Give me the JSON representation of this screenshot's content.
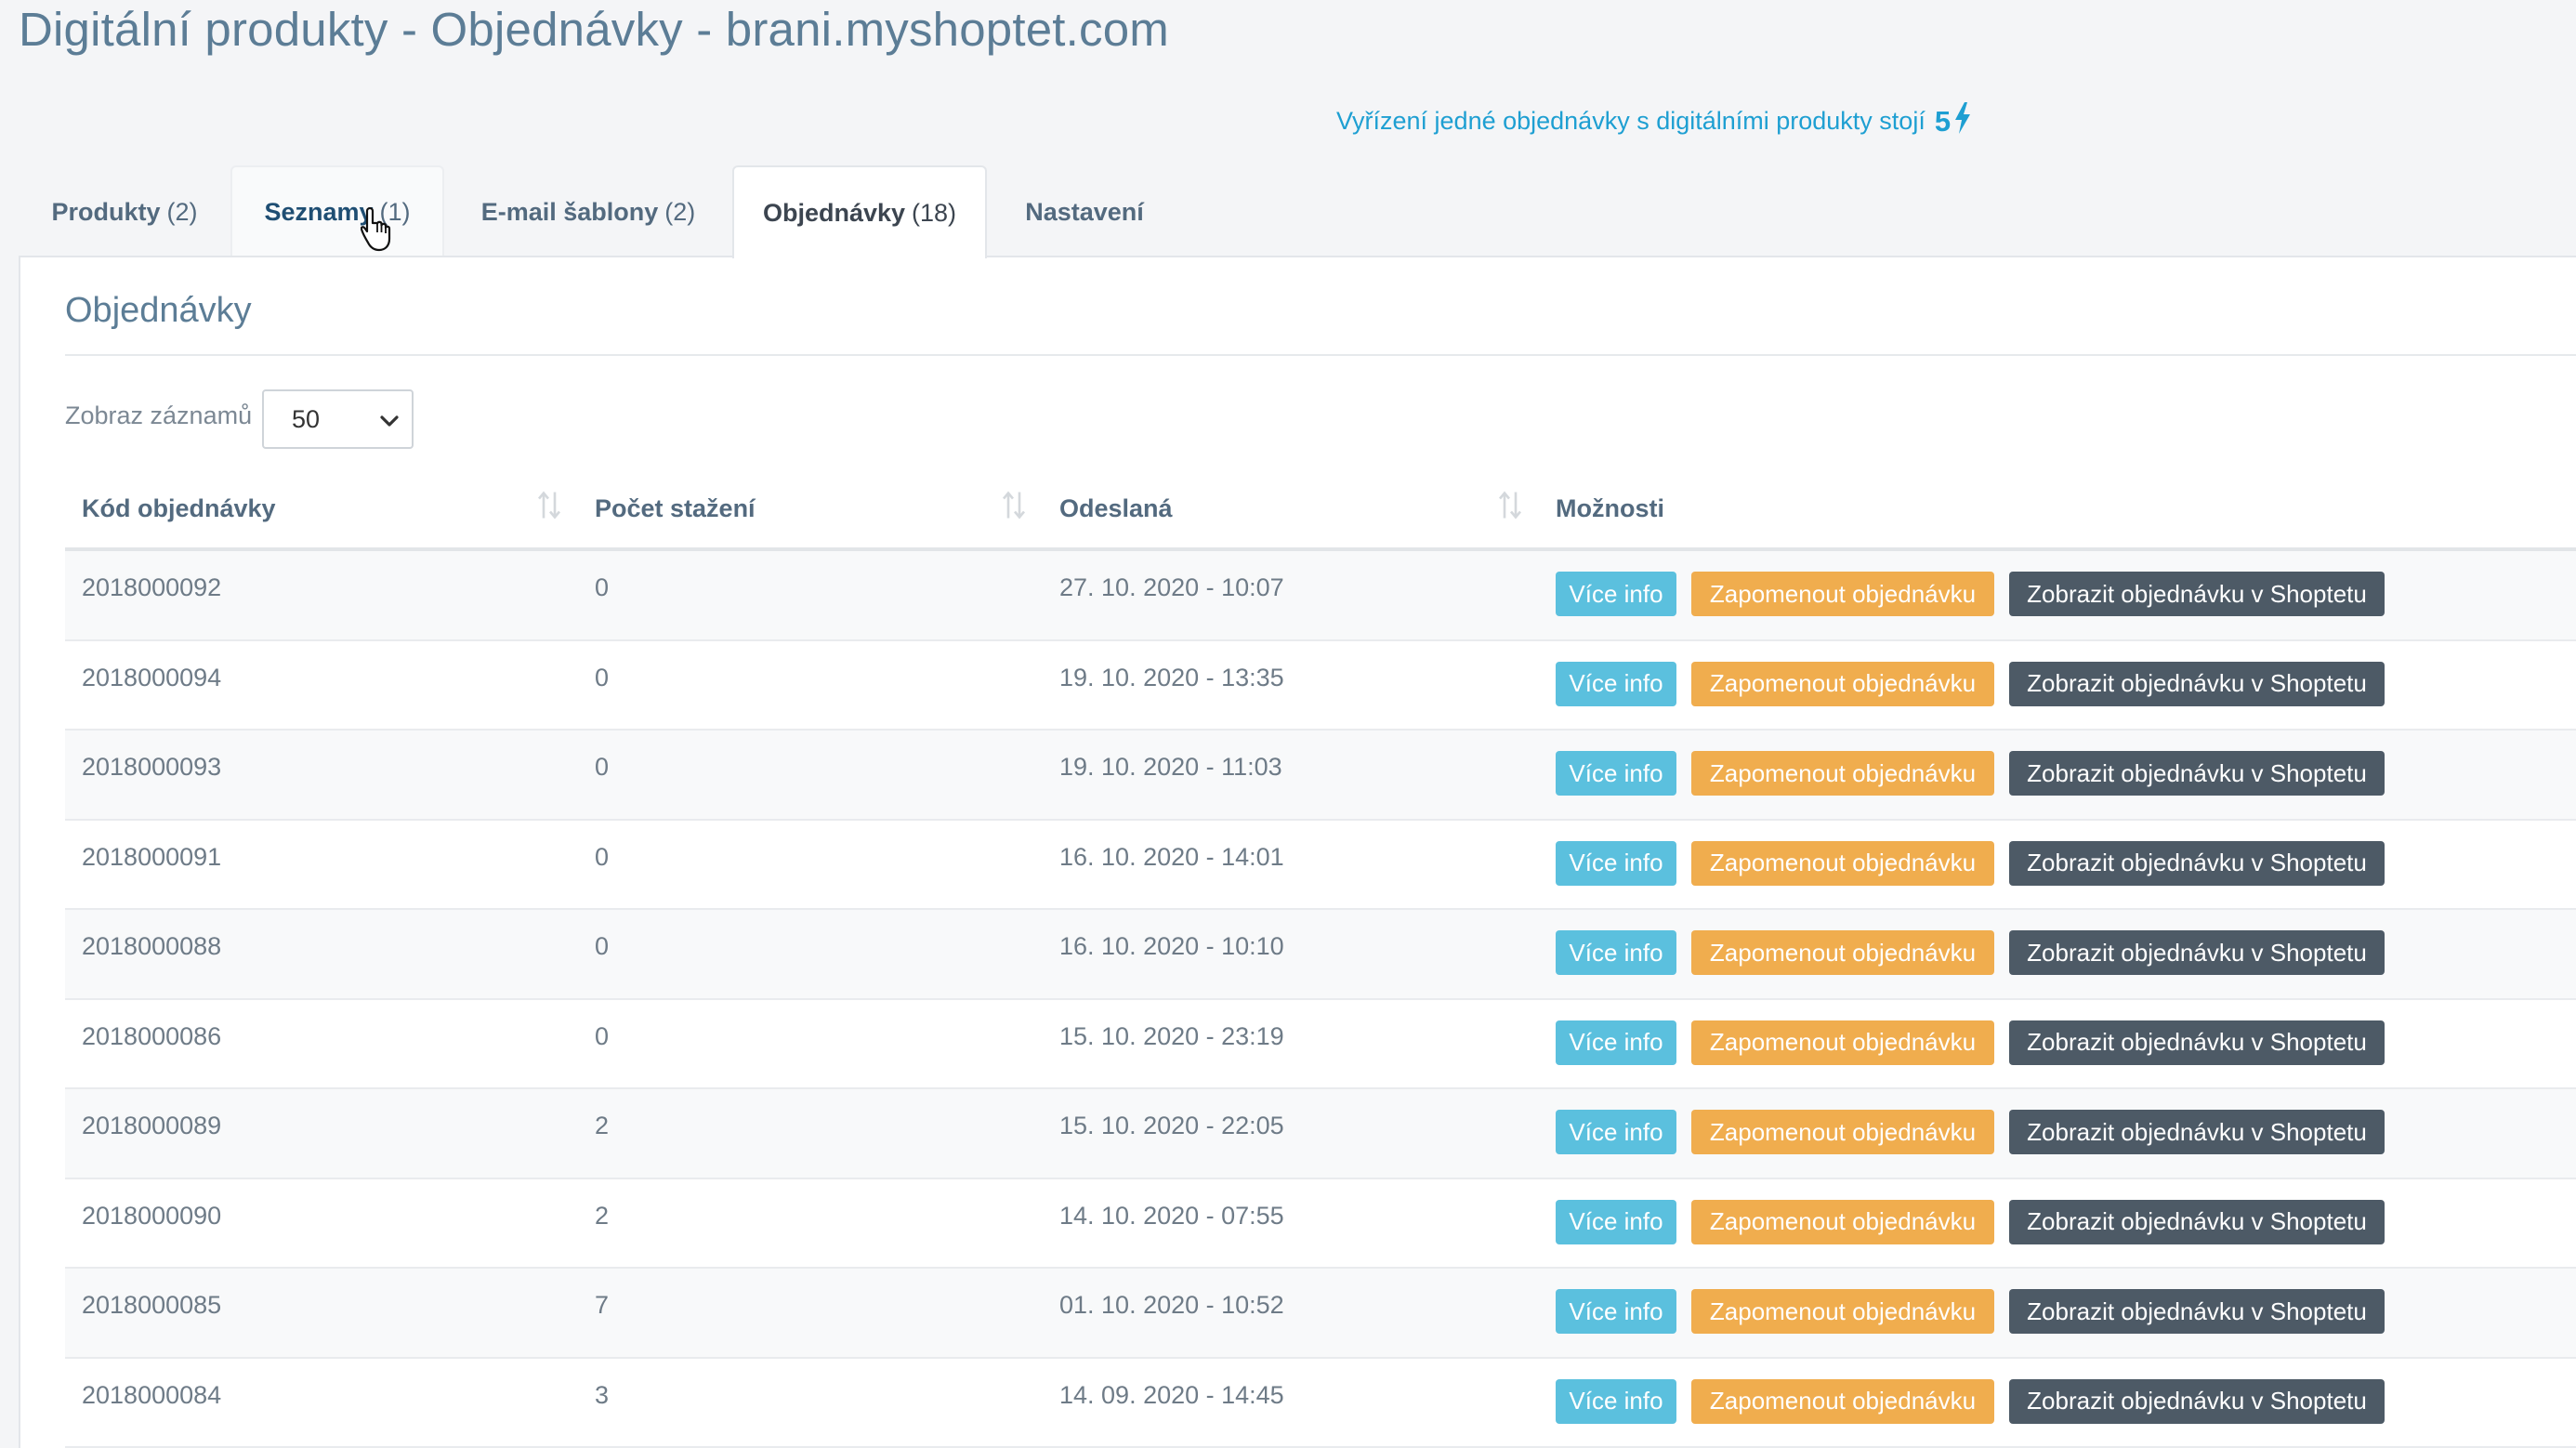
{
  "page": {
    "title": "Digitální produkty - Objednávky - brani.myshoptet.com",
    "cost_note_text": "Vyřízení jedné objednávky s digitálními produkty stojí",
    "cost_value": "5",
    "cost_icon": "lightning-bolt-icon"
  },
  "tabs": [
    {
      "label": "Produkty",
      "count": "(2)",
      "active": false
    },
    {
      "label": "Seznamy",
      "count": "(1)",
      "active": false,
      "hovered": true
    },
    {
      "label": "E-mail šablony",
      "count": "(2)",
      "active": false
    },
    {
      "label": "Objednávky",
      "count": "(18)",
      "active": true
    },
    {
      "label": "Nastavení",
      "count": "",
      "active": false
    }
  ],
  "panel": {
    "title": "Objednávky",
    "length_label": "Zobraz záznamů",
    "length_value": "50"
  },
  "table": {
    "headers": [
      "Kód objednávky",
      "Počet stažení",
      "Odeslaná",
      "Možnosti"
    ],
    "buttons": {
      "info": "Více info",
      "forget": "Zapomenout objednávku",
      "show": "Zobrazit objednávku v Shoptetu"
    },
    "rows": [
      {
        "code": "2018000092",
        "downloads": "0",
        "sent": "27. 10. 2020 - 10:07"
      },
      {
        "code": "2018000094",
        "downloads": "0",
        "sent": "19. 10. 2020 - 13:35"
      },
      {
        "code": "2018000093",
        "downloads": "0",
        "sent": "19. 10. 2020 - 11:03"
      },
      {
        "code": "2018000091",
        "downloads": "0",
        "sent": "16. 10. 2020 - 14:01"
      },
      {
        "code": "2018000088",
        "downloads": "0",
        "sent": "16. 10. 2020 - 10:10"
      },
      {
        "code": "2018000086",
        "downloads": "0",
        "sent": "15. 10. 2020 - 23:19"
      },
      {
        "code": "2018000089",
        "downloads": "2",
        "sent": "15. 10. 2020 - 22:05"
      },
      {
        "code": "2018000090",
        "downloads": "2",
        "sent": "14. 10. 2020 - 07:55"
      },
      {
        "code": "2018000085",
        "downloads": "7",
        "sent": "01. 10. 2020 - 10:52"
      },
      {
        "code": "2018000084",
        "downloads": "3",
        "sent": "14. 09. 2020 - 14:45"
      }
    ]
  },
  "colors": {
    "title": "#5c7d96",
    "accent": "#1e9fd2",
    "btn_info": "#5bc0de",
    "btn_forget": "#f0ad4e",
    "btn_show": "#4d5a66"
  }
}
